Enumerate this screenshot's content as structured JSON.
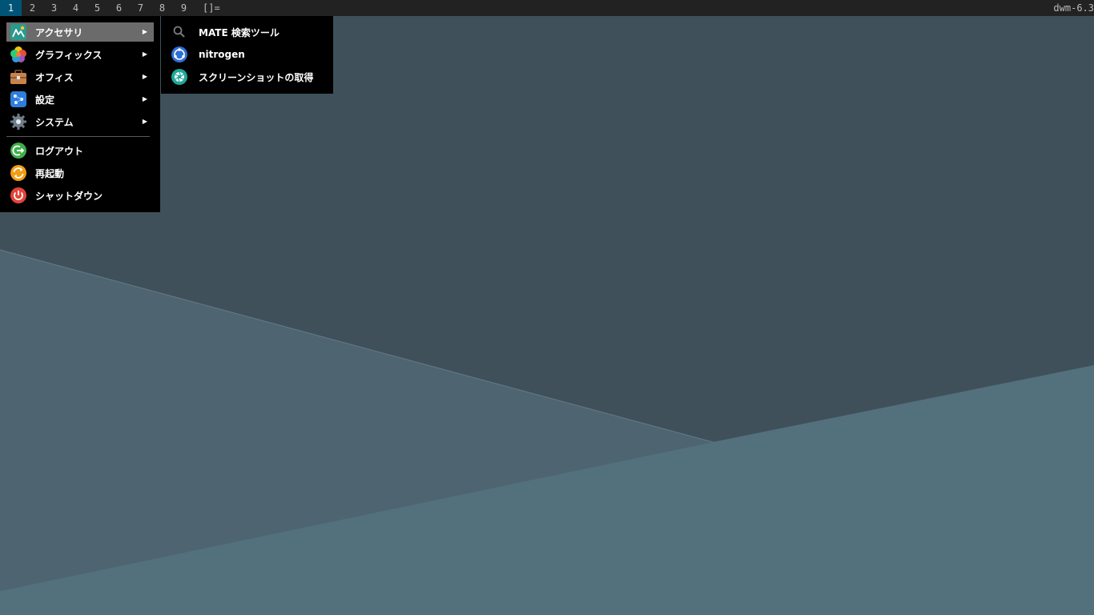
{
  "bar": {
    "tags": [
      "1",
      "2",
      "3",
      "4",
      "5",
      "6",
      "7",
      "8",
      "9"
    ],
    "active_tag": "1",
    "layout_symbol": "[]=",
    "status_text": "dwm-6.3",
    "colors": {
      "bar_bg": "#222222",
      "active_tag_bg": "#005577"
    }
  },
  "main_menu": {
    "items": [
      {
        "label": "アクセサリ",
        "icon": "accessories-icon",
        "arrow": "▶"
      },
      {
        "label": "グラフィックス",
        "icon": "graphics-icon",
        "arrow": "▶"
      },
      {
        "label": "オフィス",
        "icon": "office-icon",
        "arrow": "▶"
      },
      {
        "label": "設定",
        "icon": "settings-icon",
        "arrow": "▶"
      },
      {
        "label": "システム",
        "icon": "system-gear-icon",
        "arrow": "▶"
      },
      {
        "label": "ログアウト",
        "icon": "logout-icon"
      },
      {
        "label": "再起動",
        "icon": "reboot-icon"
      },
      {
        "label": "シャットダウン",
        "icon": "shutdown-icon"
      }
    ],
    "selected_index": 0
  },
  "submenu": {
    "items": [
      {
        "label": "MATE 検索ツール",
        "icon": "search-icon"
      },
      {
        "label": "nitrogen",
        "icon": "nitrogen-icon"
      },
      {
        "label": "スクリーンショットの取得",
        "icon": "screenshot-aperture-icon"
      }
    ]
  }
}
